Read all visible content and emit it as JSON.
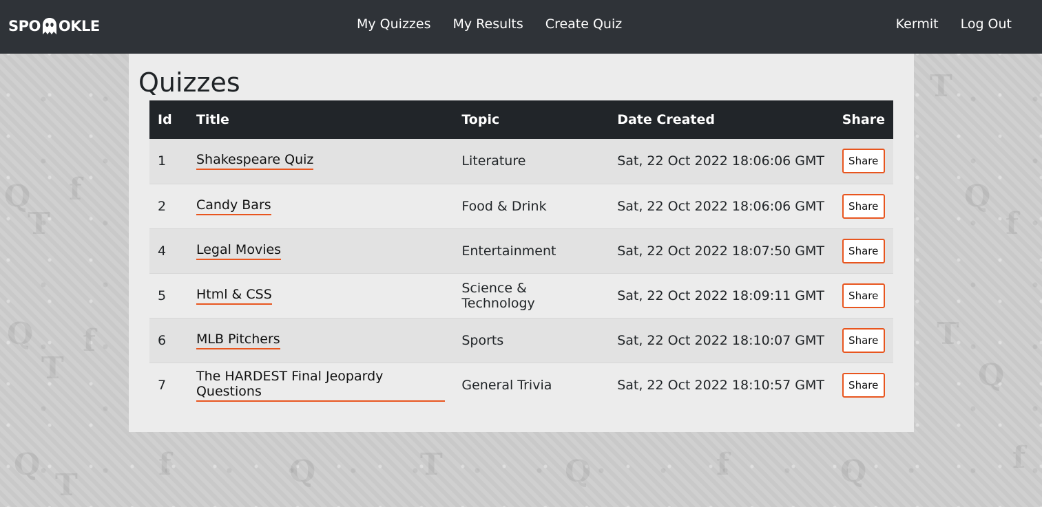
{
  "brand": {
    "name_left": "SPO",
    "name_right": "OKLE",
    "logo_icon": "ghost-icon"
  },
  "nav": {
    "center": [
      "My Quizzes",
      "My Results",
      "Create Quiz"
    ],
    "right": [
      "Kermit",
      "Log Out"
    ]
  },
  "page": {
    "title": "Quizzes"
  },
  "table": {
    "headers": [
      "Id",
      "Title",
      "Topic",
      "Date Created",
      "Share"
    ],
    "rows": [
      {
        "id": "1",
        "title": "Shakespeare Quiz",
        "topic": "Literature",
        "date": "Sat, 22 Oct 2022 18:06:06 GMT",
        "share": "Share"
      },
      {
        "id": "2",
        "title": "Candy Bars",
        "topic": "Food & Drink",
        "date": "Sat, 22 Oct 2022 18:06:06 GMT",
        "share": "Share"
      },
      {
        "id": "4",
        "title": "Legal Movies",
        "topic": "Entertainment",
        "date": "Sat, 22 Oct 2022 18:07:50 GMT",
        "share": "Share"
      },
      {
        "id": "5",
        "title": "Html & CSS",
        "topic": "Science & Technology",
        "date": "Sat, 22 Oct 2022 18:09:11 GMT",
        "share": "Share"
      },
      {
        "id": "6",
        "title": "MLB Pitchers",
        "topic": "Sports",
        "date": "Sat, 22 Oct 2022 18:10:07 GMT",
        "share": "Share"
      },
      {
        "id": "7",
        "title": "The HARDEST Final Jeopardy Questions",
        "topic": "General Trivia",
        "date": "Sat, 22 Oct 2022 18:10:57 GMT",
        "share": "Share"
      }
    ]
  },
  "colors": {
    "navbar": "#2f3338",
    "table_header": "#212529",
    "accent": "#e8551e",
    "panel": "#ececec"
  }
}
